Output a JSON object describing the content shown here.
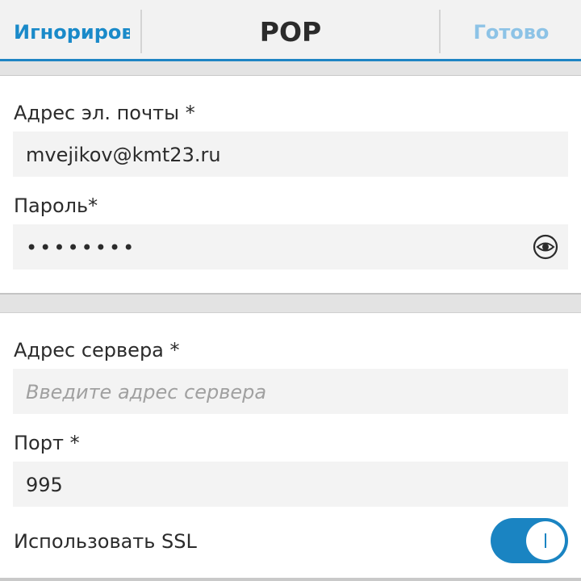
{
  "titlebar": {
    "cancel_label": "Игнориров",
    "title": "POP",
    "done_label": "Готово"
  },
  "account": {
    "email_label": "Адрес эл. почты *",
    "email_value": "mvejikov@kmt23.ru",
    "password_label": "Пароль*",
    "password_value": "••••••••",
    "password_reveal_icon": "eye-icon"
  },
  "server": {
    "address_label": "Адрес сервера *",
    "address_placeholder": "Введите адрес сервера",
    "port_label": "Порт *",
    "port_value": "995",
    "ssl_label": "Использовать SSL",
    "ssl_enabled": true
  },
  "colors": {
    "accent": "#1a84c2",
    "done_disabled": "#8dc3e6"
  }
}
